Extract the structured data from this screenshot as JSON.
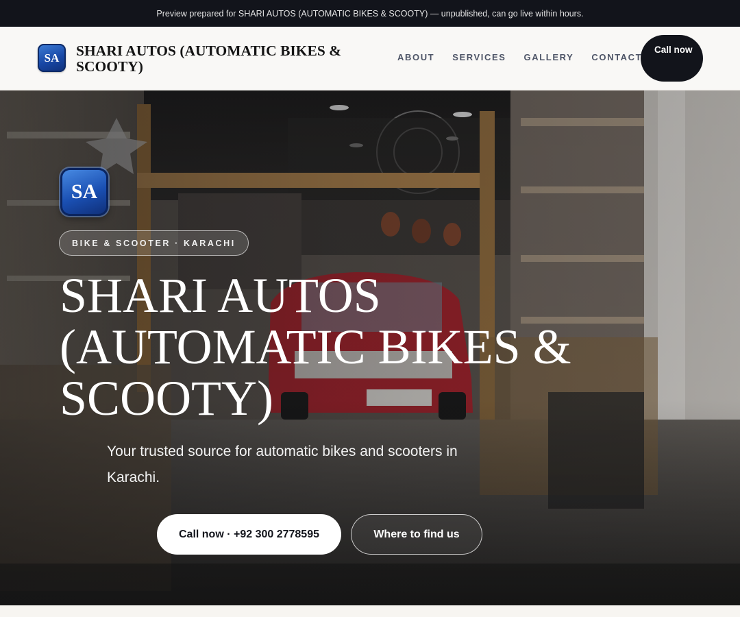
{
  "preview_banner": "Preview prepared for SHARI AUTOS (AUTOMATIC BIKES & SCOOTY) — unpublished, can go live within hours.",
  "header": {
    "logo_initials": "SA",
    "brand_name": "SHARI AUTOS (AUTOMATIC BIKES & SCOOTY)",
    "nav": [
      "ABOUT",
      "SERVICES",
      "GALLERY",
      "CONTACT"
    ],
    "call_button": "Call now"
  },
  "hero": {
    "logo_initials": "SA",
    "tag": "BIKE & SCOOTER · KARACHI",
    "title": "SHARI AUTOS (AUTOMATIC BIKES & SCOOTY)",
    "subtitle": "Your trusted source for automatic bikes and scooters in Karachi.",
    "primary_button": "Call now · +92 300 2778595",
    "secondary_button": "Where to find us",
    "background_photo": "shop interior with red car"
  },
  "colors": {
    "dark": "#12141b",
    "logo_blue": "#1848a6",
    "nav_text": "#4e5567"
  }
}
